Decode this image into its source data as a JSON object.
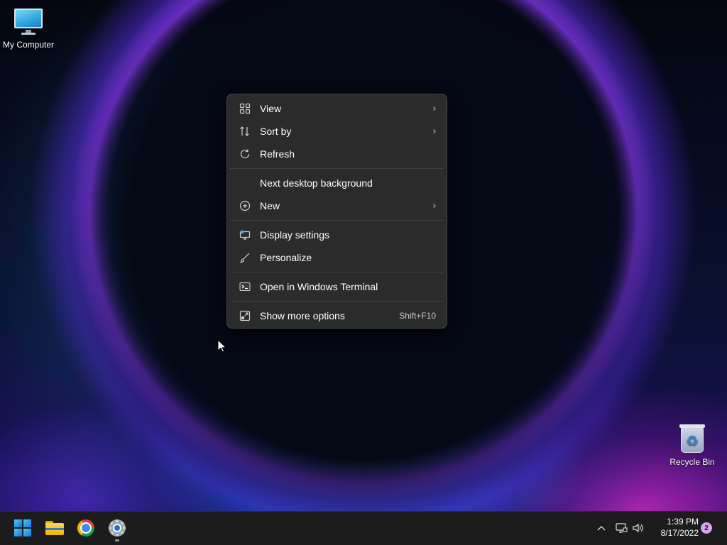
{
  "desktop": {
    "icons": [
      {
        "label": "My Computer",
        "icon": "monitor-icon"
      },
      {
        "label": "Recycle Bin",
        "icon": "recycle-bin-icon"
      }
    ]
  },
  "context_menu": {
    "items": [
      {
        "label": "View",
        "icon": "grid-view-icon",
        "submenu": true
      },
      {
        "label": "Sort by",
        "icon": "sort-icon",
        "submenu": true
      },
      {
        "label": "Refresh",
        "icon": "refresh-icon"
      },
      {
        "label": "Next desktop background",
        "icon": ""
      },
      {
        "label": "New",
        "icon": "plus-circle-icon",
        "submenu": true
      },
      {
        "label": "Display settings",
        "icon": "display-settings-icon"
      },
      {
        "label": "Personalize",
        "icon": "brush-icon"
      },
      {
        "label": "Open in Windows Terminal",
        "icon": "terminal-icon"
      },
      {
        "label": "Show more options",
        "icon": "more-options-icon",
        "shortcut": "Shift+F10"
      }
    ]
  },
  "taskbar": {
    "apps": [
      {
        "name": "Start",
        "icon": "windows-start-icon"
      },
      {
        "name": "File Explorer",
        "icon": "folder-icon"
      },
      {
        "name": "Google Chrome",
        "icon": "chrome-icon"
      },
      {
        "name": "Settings",
        "icon": "gear-icon"
      }
    ],
    "tray": {
      "time": "1:39 PM",
      "date": "8/17/2022",
      "notification_count": "2"
    }
  },
  "colors": {
    "menu_background": "#2b2b2b",
    "taskbar_background": "#1c1c1c",
    "accent": "#0a78d6",
    "notification_badge": "#d9a5f0"
  }
}
